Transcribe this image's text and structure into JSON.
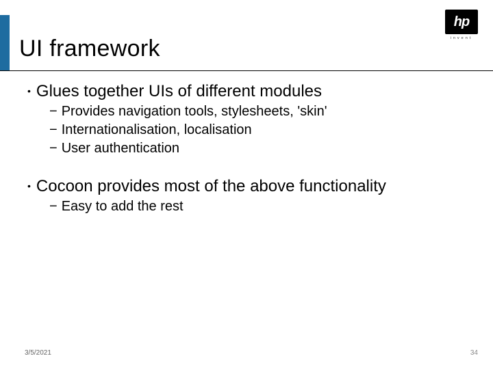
{
  "logo": {
    "text": "hp",
    "sub": "invent"
  },
  "title": "UI framework",
  "bullets": [
    {
      "text": "Glues together UIs of different modules",
      "subs": [
        "Provides navigation tools, stylesheets, 'skin'",
        "Internationalisation, localisation",
        "User authentication"
      ]
    },
    {
      "text": "Cocoon provides most of the above functionality",
      "subs": [
        "Easy to add the rest"
      ]
    }
  ],
  "footer": {
    "date": "3/5/2021",
    "page": "34"
  }
}
